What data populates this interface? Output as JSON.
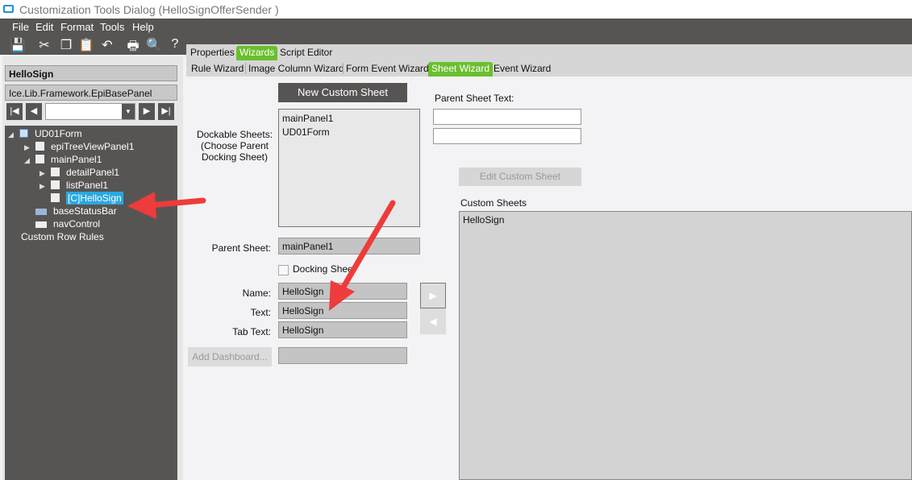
{
  "window": {
    "title": "Customization Tools Dialog  (HelloSignOfferSender )"
  },
  "menu": [
    "File",
    "Edit",
    "Format",
    "Tools",
    "Help"
  ],
  "toolbar": [
    "save-icon",
    "cut-icon",
    "copy-icon",
    "paste-icon",
    "undo-icon",
    "print-icon",
    "print-preview-icon",
    "help-icon"
  ],
  "left": {
    "control_name": "HelloSign",
    "control_type": "Ice.Lib.Framework.EpiBasePanel",
    "tree": [
      {
        "label": "UD01Form"
      },
      {
        "label": "epiTreeViewPanel1"
      },
      {
        "label": "mainPanel1"
      },
      {
        "label": "detailPanel1"
      },
      {
        "label": "listPanel1"
      },
      {
        "label": "[C]HelloSign"
      },
      {
        "label": "baseStatusBar"
      },
      {
        "label": "navControl"
      },
      {
        "label": "Custom Row Rules"
      }
    ]
  },
  "tabs": [
    "Properties",
    "Wizards",
    "Script Editor"
  ],
  "subtabs": [
    "Rule Wizard",
    "Image Column Wizard",
    "Form Event Wizard",
    "Sheet Wizard",
    "Event Wizard"
  ],
  "sheet": {
    "new_button": "New Custom Sheet",
    "dockable_label": "Dockable Sheets:\n(Choose Parent\nDocking Sheet)",
    "dockable": [
      "mainPanel1",
      "UD01Form"
    ],
    "parent_text_label": "Parent Sheet Text:",
    "parent_text_1": "",
    "parent_text_2": "",
    "edit_button": "Edit Custom Sheet",
    "custom_sheets_label": "Custom Sheets",
    "custom_sheets": [
      "HelloSign"
    ],
    "parent_sheet_label": "Parent Sheet:",
    "parent_sheet": "mainPanel1",
    "docking_label": "Docking Sheet",
    "name_label": "Name:",
    "name": "HelloSign",
    "text_label": "Text:",
    "text": "HelloSign",
    "tabtext_label": "Tab Text:",
    "tabtext": "HelloSign",
    "dashboard_button": "Add Dashboard...",
    "dashboard": ""
  },
  "colors": {
    "accent": "#6abf2e",
    "dark": "#575553",
    "selection": "#29a8e0",
    "arrow": "#ee3b3b"
  }
}
